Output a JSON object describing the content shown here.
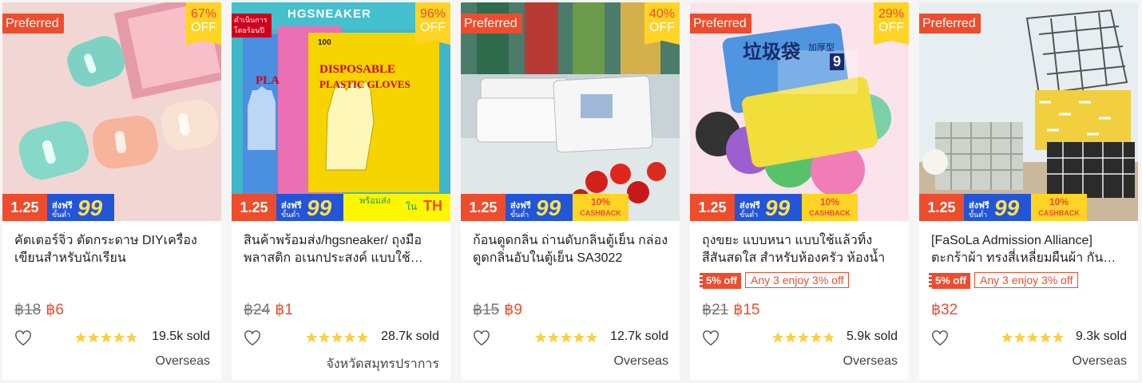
{
  "theme": {
    "accent": "#ee4d2d",
    "badge_yellow": "#ffd424",
    "ship_blue": "#2355d8"
  },
  "cards": [
    {
      "preferred": "Preferred",
      "discount_pct": "67%",
      "discount_off": "OFF",
      "badge_date": "1.25",
      "badge_ship_top": "ส่งฟรี",
      "badge_ship_bottom": "ขั้นต่ำ",
      "badge_ship_num": "99",
      "title": "คัตเตอร์จิ๋ว ตัดกระดาษ DIYเครื่องเขียนสำหรับนักเรียน",
      "price_old": "฿18",
      "price_new": "฿6",
      "rating": 4.8,
      "sold": "19.5k sold",
      "location": "Overseas"
    },
    {
      "brand_label": "HGSNEAKER",
      "mall_tag": "ดำเนินการโดยร้อนปี",
      "discount_pct": "96%",
      "discount_off": "OFF",
      "pack_count": "100",
      "pack_text_1": "DISPOSABLE",
      "pack_text_2": "PLASTIC GLOVES",
      "pack_partial": "PLA",
      "badge_date": "1.25",
      "badge_ship_top": "ส่งฟรี",
      "badge_ship_bottom": "ขั้นต่ำ",
      "badge_ship_num": "99",
      "badge_th_text": "พร้อมส่ง",
      "badge_th_in": "ใน",
      "badge_th": "TH",
      "title": "สินค้าพร้อมส่ง/hgsneaker/ ถุงมือพลาสติก อเนกประสงค์ แบบใช้…",
      "price_old": "฿24",
      "price_new": "฿1",
      "rating": 5,
      "sold": "28.7k sold",
      "location": "จังหวัดสมุทรปราการ"
    },
    {
      "preferred": "Preferred",
      "discount_pct": "40%",
      "discount_off": "OFF",
      "badge_date": "1.25",
      "badge_ship_top": "ส่งฟรี",
      "badge_ship_bottom": "ขั้นต่ำ",
      "badge_ship_num": "99",
      "badge_cash_top": "10%",
      "badge_cash_bottom": "CASHBACK",
      "title": "ก้อนดูดกลิ่น ถ่านดับกลิ่นตู้เย็น กล่องดูดกลิ่นอับในตู้เย็น SA3022",
      "price_old": "฿15",
      "price_new": "฿9",
      "rating": 5,
      "sold": "12.7k sold",
      "location": "Overseas"
    },
    {
      "preferred": "Preferred",
      "discount_pct": "29%",
      "discount_off": "OFF",
      "bag_label": "垃圾袋",
      "bag_label_small": "加厚型",
      "bag_count": "9",
      "badge_date": "1.25",
      "badge_ship_top": "ส่งฟรี",
      "badge_ship_bottom": "ขั้นต่ำ",
      "badge_ship_num": "99",
      "badge_cash_top": "10%",
      "badge_cash_bottom": "CASHBACK",
      "title": "ถุงขยะ แบบหนา แบบใช้แล้วทิ้ง สีสันสดใส สำหรับห้องครัว ห้องน้ำ",
      "promo_1": "5% off",
      "promo_2": "Any 3 enjoy 3% off",
      "price_old": "฿21",
      "price_new": "฿15",
      "rating": 4.8,
      "sold": "5.9k sold",
      "location": "Overseas"
    },
    {
      "preferred": "Preferred",
      "badge_date": "1.25",
      "badge_ship_top": "ส่งฟรี",
      "badge_ship_bottom": "ขั้นต่ำ",
      "badge_ship_num": "99",
      "badge_cash_top": "10%",
      "badge_cash_bottom": "CASHBACK",
      "title": "[FaSoLa Admission Alliance] ตะกร้าผ้า ทรงสี่เหลี่ยมผืนผ้า กัน…",
      "promo_1": "5% off",
      "promo_2": "Any 3 enjoy 3% off",
      "price_new": "฿32",
      "rating": 5,
      "sold": "9.3k sold",
      "location": "Overseas"
    }
  ]
}
